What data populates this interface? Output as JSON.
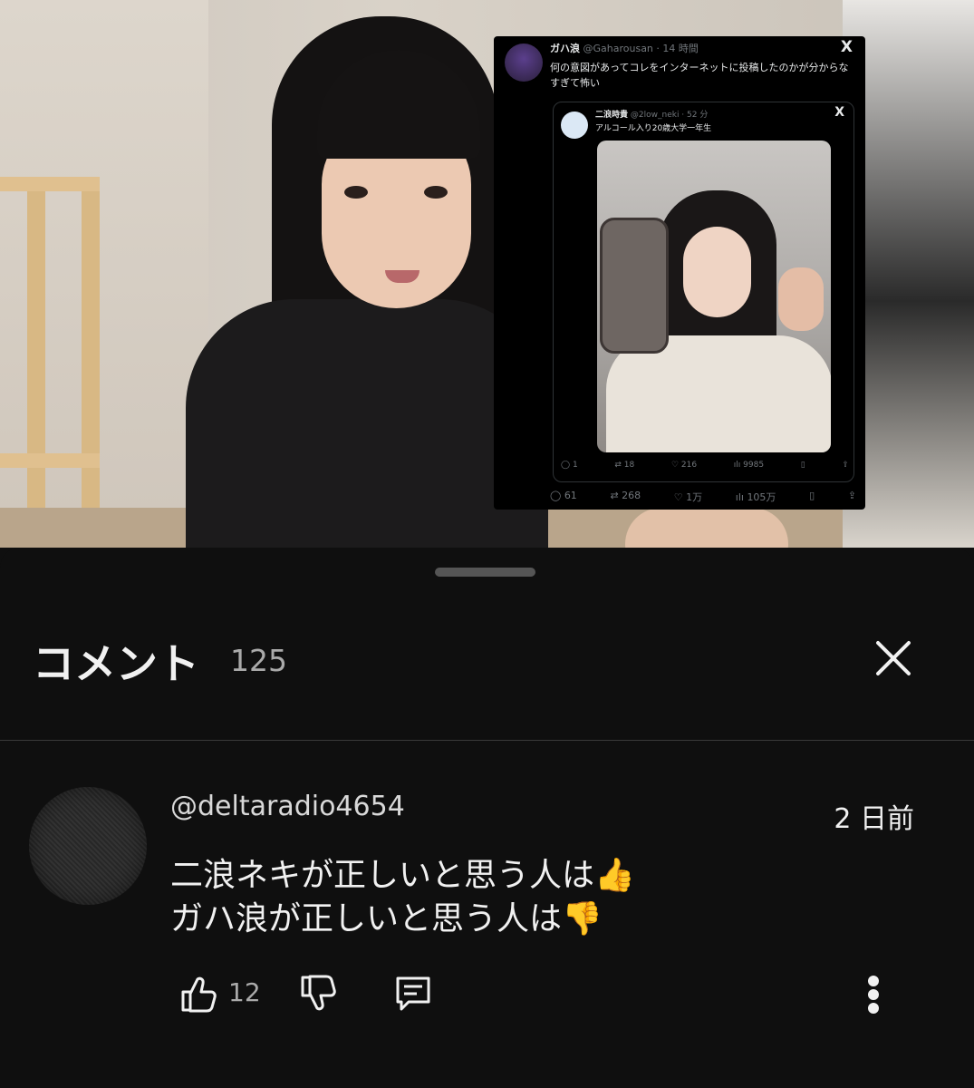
{
  "tweet": {
    "name": "ガハ浪",
    "handle_time": "@Gaharousan · 14 時間",
    "x_logo": "X",
    "text": "何の意図があってコレをインターネットに投稿したのかが分からなすぎて怖い",
    "quoted": {
      "name": "二浪時貴",
      "handle_time": "@2low_neki · 52 分",
      "x_logo": "X",
      "text": "アルコール入り20歳大学一年生",
      "stats": {
        "replies": "1",
        "retweets": "18",
        "likes": "216",
        "views": "9985"
      }
    },
    "stats": {
      "replies": "61",
      "retweets": "268",
      "likes": "1万",
      "views": "105万"
    }
  },
  "comments_panel": {
    "title": "コメント",
    "count": "125",
    "comment": {
      "author": "@deltaradio4654",
      "time": "2 日前",
      "line1": "二浪ネキが正しいと思う人は👍",
      "line2": "ガハ浪が正しいと思う人は👎",
      "like_count": "12"
    }
  },
  "icons": [
    "close-icon",
    "thumbs-up-icon",
    "thumbs-down-icon",
    "reply-icon",
    "more-vert-icon"
  ]
}
